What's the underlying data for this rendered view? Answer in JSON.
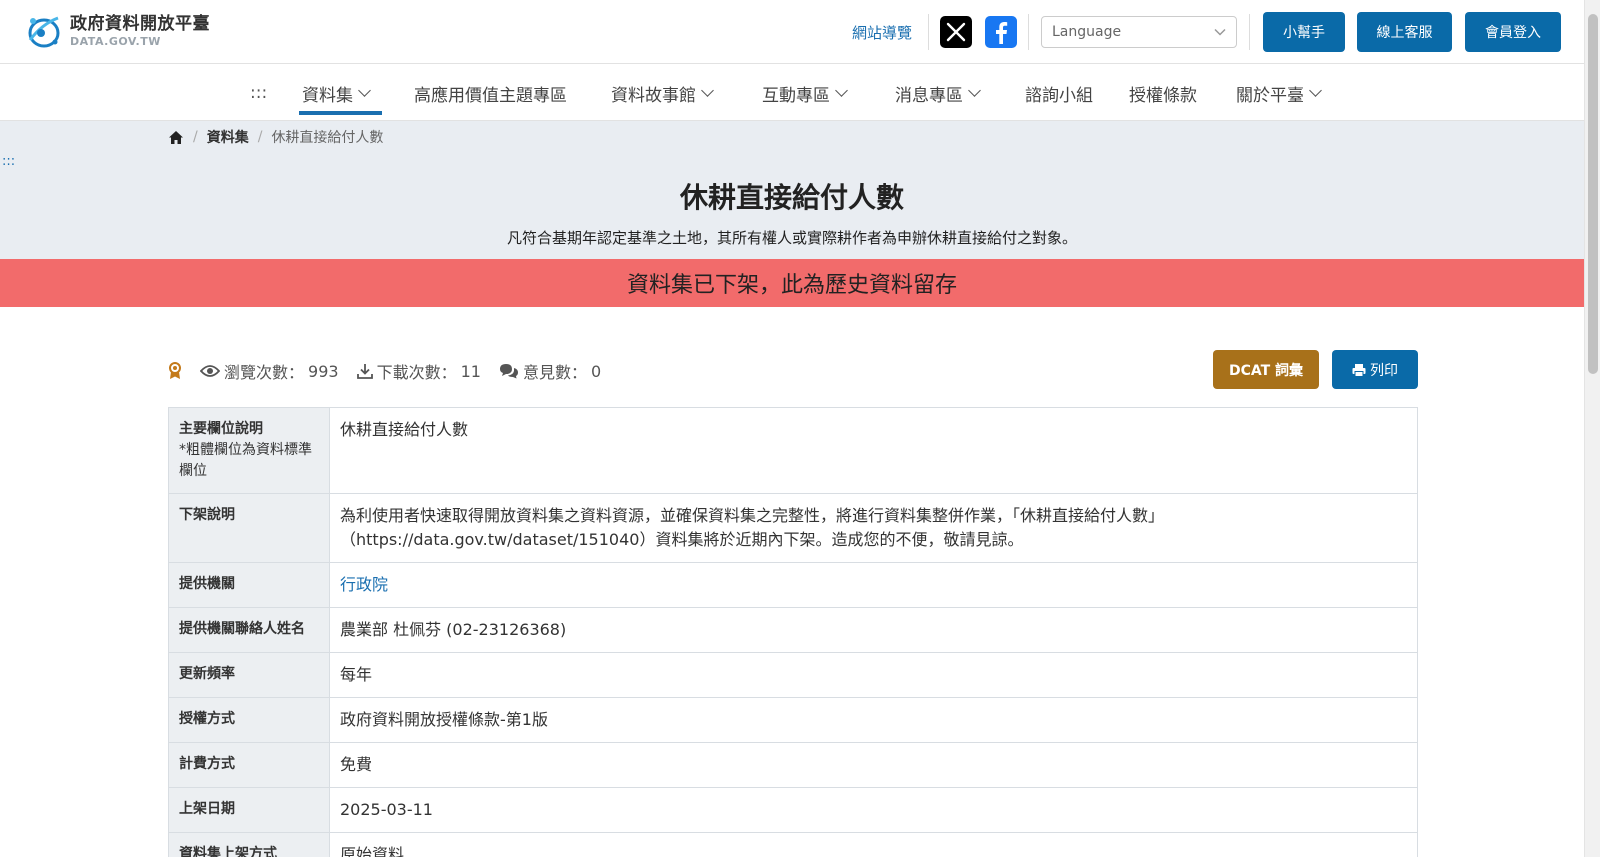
{
  "header": {
    "logo_title": "政府資料開放平臺",
    "logo_sub": "DATA.GOV.TW",
    "sitemap": "網站導覽",
    "language_placeholder": "Language",
    "buttons": {
      "helper": "小幫手",
      "service": "線上客服",
      "login": "會員登入"
    }
  },
  "nav": {
    "skip": ":::",
    "items": [
      {
        "label": "資料集",
        "has_dropdown": true,
        "active": true
      },
      {
        "label": "高應用價值主題專區",
        "has_dropdown": false
      },
      {
        "label": "資料故事館",
        "has_dropdown": true
      },
      {
        "label": "互動專區",
        "has_dropdown": true
      },
      {
        "label": "消息專區",
        "has_dropdown": true
      },
      {
        "label": "諮詢小組",
        "has_dropdown": false
      },
      {
        "label": "授權條款",
        "has_dropdown": false
      },
      {
        "label": "關於平臺",
        "has_dropdown": true
      }
    ]
  },
  "breadcrumb": {
    "section": "資料集",
    "current": "休耕直接給付人數"
  },
  "skip_anchor": ":::",
  "page": {
    "title": "休耕直接給付人數",
    "description": "凡符合基期年認定基準之土地，其所有權人或實際耕作者為申辦休耕直接給付之對象。",
    "alert": "資料集已下架，此為歷史資料留存"
  },
  "stats": {
    "views_label": "瀏覽次數：",
    "views": "993",
    "downloads_label": "下載次數：",
    "downloads": "11",
    "comments_label": "意見數：",
    "comments": "0"
  },
  "actions": {
    "dcat": "DCAT 詞彙",
    "print": "列印"
  },
  "table": {
    "main_field_key": "主要欄位說明",
    "main_field_note": "*粗體欄位為資料標準欄位",
    "main_field_value": "休耕直接給付人數",
    "rows": [
      {
        "key": "下架說明",
        "value": "為利使用者快速取得開放資料集之資料資源，並確保資料集之完整性，將進行資料集整併作業，「休耕直接給付人數」（https://data.gov.tw/dataset/151040）資料集將於近期內下架。造成您的不便，敬請見諒。"
      },
      {
        "key": "提供機關",
        "value": "行政院",
        "link": true
      },
      {
        "key": "提供機關聯絡人姓名",
        "value": "農業部 杜佩芬 (02-23126368)"
      },
      {
        "key": "更新頻率",
        "value": "每年"
      },
      {
        "key": "授權方式",
        "value": "政府資料開放授權條款-第1版"
      },
      {
        "key": "計費方式",
        "value": "免費"
      },
      {
        "key": "上架日期",
        "value": "2025-03-11"
      },
      {
        "key": "資料集上架方式",
        "value": "原始資料"
      }
    ]
  },
  "colors": {
    "primary": "#0a6aa8",
    "dcat": "#a8711a",
    "alert": "#f26b6b",
    "hero_bg": "#e9edf2"
  }
}
